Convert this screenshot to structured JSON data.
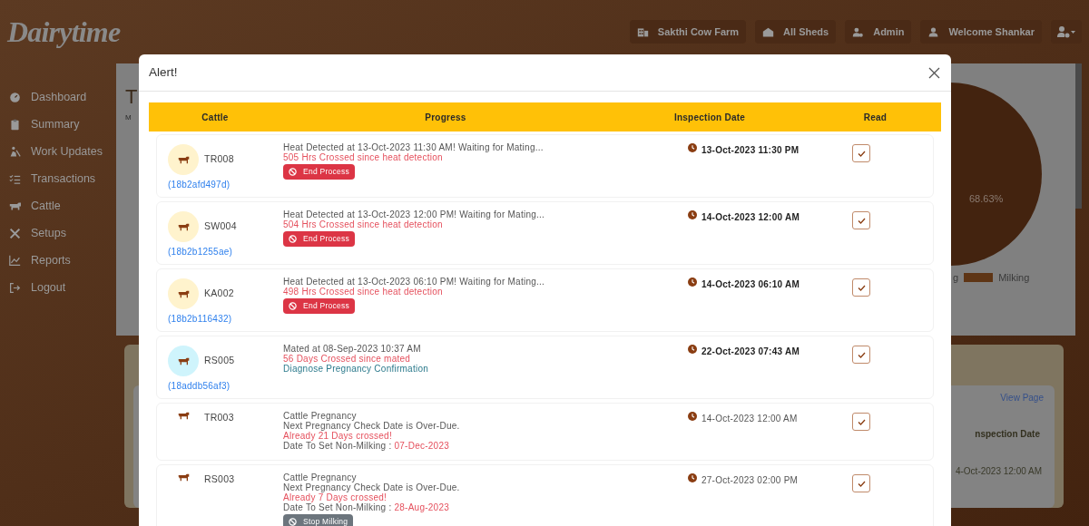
{
  "app": {
    "logo": "Dairytime"
  },
  "top_nav": [
    {
      "label": "Sakthi Cow Farm",
      "kind": "farm"
    },
    {
      "label": "All Sheds",
      "kind": "shed"
    },
    {
      "label": "Admin",
      "kind": "admin"
    },
    {
      "label": "Welcome Shankar",
      "kind": "user"
    }
  ],
  "sidebar": {
    "items": [
      {
        "label": "Dashboard",
        "kind": "dashboard"
      },
      {
        "label": "Summary",
        "kind": "summary"
      },
      {
        "label": "Work Updates",
        "kind": "work"
      },
      {
        "label": "Transactions",
        "kind": "transactions"
      },
      {
        "label": "Cattle",
        "kind": "cattle"
      },
      {
        "label": "Setups",
        "kind": "setups"
      },
      {
        "label": "Reports",
        "kind": "reports"
      },
      {
        "label": "Logout",
        "kind": "logout"
      }
    ]
  },
  "background": {
    "title": "T",
    "subtitle": "M",
    "chart_label": "68.63%",
    "legend": [
      "g",
      "Milking"
    ],
    "link": "View Page",
    "column_header": "nspection Date",
    "cell": "4-Oct-2023 12:00 AM"
  },
  "modal": {
    "title": "Alert!",
    "columns": [
      "Cattle",
      "Progress",
      "Inspection Date",
      "Read"
    ],
    "rows": [
      {
        "kind": "avatar",
        "color": "#fff3cd",
        "cattle": "TR008",
        "code": "(18b2afd497d)",
        "lines": [
          {
            "text": "Heat Detected at 13-Oct-2023 11:30 AM! Waiting for Mating...",
            "kind": "normal"
          },
          {
            "text": "505 Hrs Crossed since heat detection",
            "kind": "alert"
          }
        ],
        "button": {
          "label": "End Process",
          "kind": "danger"
        },
        "inspection_date": "13-Oct-2023 11:30 PM",
        "highlighted": true,
        "read": true
      },
      {
        "kind": "avatar",
        "color": "#fff3cd",
        "cattle": "SW004",
        "code": "(18b2b1255ae)",
        "lines": [
          {
            "text": "Heat Detected at 13-Oct-2023 12:00 PM! Waiting for Mating...",
            "kind": "normal"
          },
          {
            "text": "504 Hrs Crossed since heat detection",
            "kind": "alert"
          }
        ],
        "button": {
          "label": "End Process",
          "kind": "danger"
        },
        "inspection_date": "14-Oct-2023 12:00 AM",
        "highlighted": true,
        "read": true
      },
      {
        "kind": "avatar",
        "color": "#fff3cd",
        "cattle": "KA002",
        "code": "(18b2b116432)",
        "lines": [
          {
            "text": "Heat Detected at 13-Oct-2023 06:10 PM! Waiting for Mating...",
            "kind": "normal"
          },
          {
            "text": "498 Hrs Crossed since heat detection",
            "kind": "alert"
          }
        ],
        "button": {
          "label": "End Process",
          "kind": "danger"
        },
        "inspection_date": "14-Oct-2023 06:10 AM",
        "highlighted": true,
        "read": true
      },
      {
        "kind": "avatar",
        "color": "#cff4fc",
        "cattle": "RS005",
        "code": "(18addb56af3)",
        "lines": [
          {
            "text": "Mated at 08-Sep-2023 10:37 AM",
            "kind": "normal"
          },
          {
            "text": "56 Days Crossed since mated",
            "kind": "alert"
          },
          {
            "text": "Diagnose Pregnancy Confirmation",
            "kind": "info"
          }
        ],
        "inspection_date": "22-Oct-2023 07:43 AM",
        "highlighted": true,
        "read": true
      },
      {
        "kind": "plain",
        "cattle": "TR003",
        "lines": [
          {
            "text": "Cattle Pregnancy",
            "kind": "normal"
          },
          {
            "text": "Next Pregnancy Check Date is Over-Due.",
            "kind": "normal"
          },
          {
            "text": "Already 21 Days crossed!",
            "kind": "alert"
          },
          {
            "text": "Date To Set Non-Milking :",
            "kind": "normal",
            "value": "07-Dec-2023"
          }
        ],
        "inspection_date": "14-Oct-2023 12:00 AM",
        "highlighted": false,
        "read": true
      },
      {
        "kind": "plain",
        "cattle": "RS003",
        "lines": [
          {
            "text": "Cattle Pregnancy",
            "kind": "normal"
          },
          {
            "text": "Next Pregnancy Check Date is Over-Due.",
            "kind": "normal"
          },
          {
            "text": "Already 7 Days crossed!",
            "kind": "alert"
          },
          {
            "text": "Date To Set Non-Milking :",
            "kind": "normal",
            "value": "28-Aug-2023"
          }
        ],
        "button": {
          "label": "Stop Milking",
          "kind": "secondary"
        },
        "inspection_date": "27-Oct-2023 02:00 PM",
        "highlighted": false,
        "read": true
      }
    ]
  }
}
